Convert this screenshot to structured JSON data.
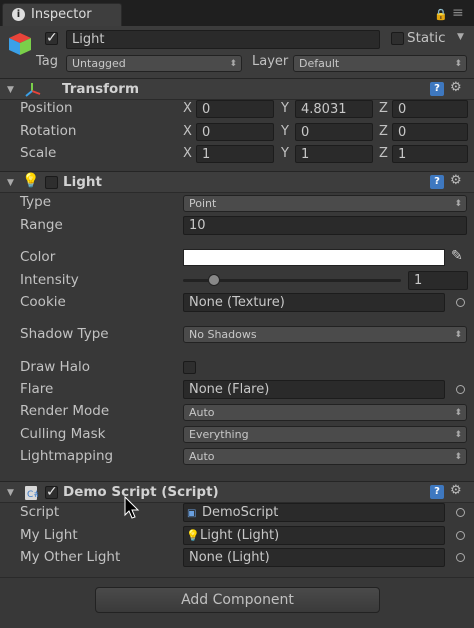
{
  "window": {
    "tab_title": "Inspector",
    "tab_icon": "i"
  },
  "object": {
    "name": "Light",
    "active": true,
    "static_label": "Static",
    "static_checked": false,
    "tag_label": "Tag",
    "tag_value": "Untagged",
    "layer_label": "Layer",
    "layer_value": "Default"
  },
  "transform": {
    "title": "Transform",
    "position_label": "Position",
    "rotation_label": "Rotation",
    "scale_label": "Scale",
    "axis_x": "X",
    "axis_y": "Y",
    "axis_z": "Z",
    "position": {
      "x": "0",
      "y": "4.8031",
      "z": "0"
    },
    "rotation": {
      "x": "0",
      "y": "0",
      "z": "0"
    },
    "scale": {
      "x": "1",
      "y": "1",
      "z": "1"
    }
  },
  "light": {
    "title": "Light",
    "enabled": false,
    "type_label": "Type",
    "type_value": "Point",
    "range_label": "Range",
    "range_value": "10",
    "color_label": "Color",
    "color_value": "#ffffff",
    "intensity_label": "Intensity",
    "intensity_value": "1",
    "intensity_fraction": 0.12,
    "cookie_label": "Cookie",
    "cookie_value": "None (Texture)",
    "shadow_label": "Shadow Type",
    "shadow_value": "No Shadows",
    "halo_label": "Draw Halo",
    "halo_checked": false,
    "flare_label": "Flare",
    "flare_value": "None (Flare)",
    "render_label": "Render Mode",
    "render_value": "Auto",
    "culling_label": "Culling Mask",
    "culling_value": "Everything",
    "lightmap_label": "Lightmapping",
    "lightmap_value": "Auto"
  },
  "demo_script": {
    "title": "Demo Script (Script)",
    "enabled": true,
    "script_label": "Script",
    "script_value": "DemoScript",
    "my_light_label": "My Light",
    "my_light_value": "Light (Light)",
    "my_other_light_label": "My Other Light",
    "my_other_light_value": "None (Light)"
  },
  "add_component_label": "Add Component",
  "colors": {
    "help_icon": "#3e78c0",
    "bg": "#383838"
  }
}
